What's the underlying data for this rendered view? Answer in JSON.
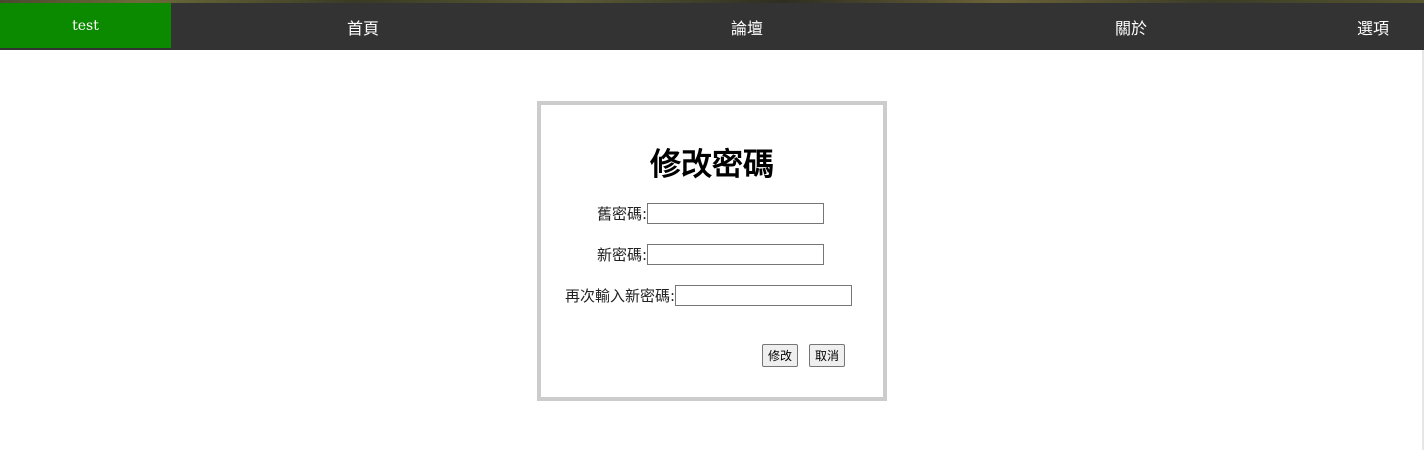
{
  "nav": {
    "user_label": "test",
    "items": [
      {
        "label": "首頁"
      },
      {
        "label": "論壇"
      },
      {
        "label": "關於"
      },
      {
        "label": "選項"
      }
    ],
    "user_bg_color": "#0b8a00",
    "bar_color": "#333333"
  },
  "form": {
    "title": "修改密碼",
    "old_password_label": "舊密碼:",
    "old_password_value": "",
    "new_password_label": "新密碼:",
    "new_password_value": "",
    "confirm_password_label": "再次輸入新密碼:",
    "confirm_password_value": "",
    "submit_label": "修改",
    "cancel_label": "取消"
  }
}
